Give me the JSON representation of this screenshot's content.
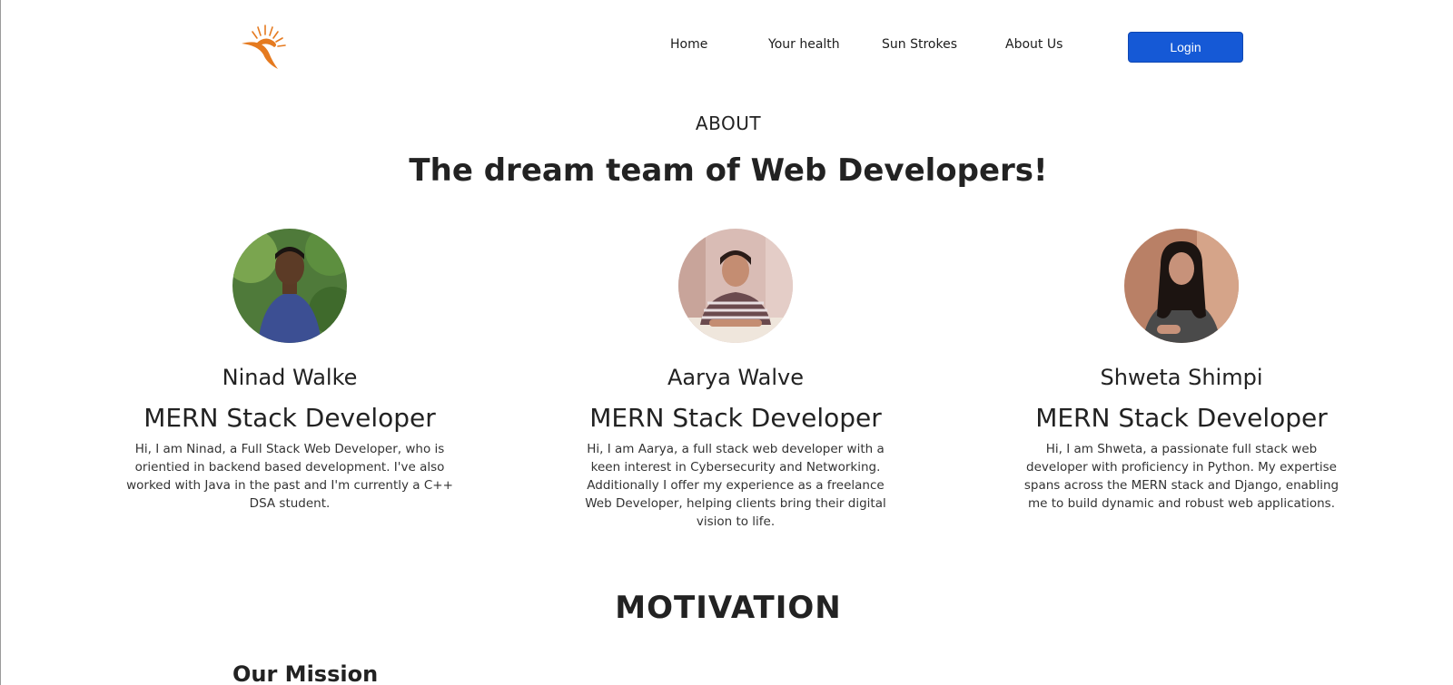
{
  "nav": {
    "items": [
      {
        "label": "Home"
      },
      {
        "label": "Your health"
      },
      {
        "label": "Sun Strokes"
      },
      {
        "label": "About Us"
      }
    ],
    "login_label": "Login"
  },
  "brand": {
    "logo_icon": "sun-logo-icon",
    "accent": "#e57a1f"
  },
  "about": {
    "label": "ABOUT",
    "title": "The dream team of Web Developers!"
  },
  "team": [
    {
      "name": "Ninad Walke",
      "role": "MERN Stack Developer",
      "bio": "Hi, I am Ninad, a Full Stack Web Developer, who is orientied in backend based development. I've also worked with Java in the past and I'm currently a C++ DSA student."
    },
    {
      "name": "Aarya Walve",
      "role": "MERN Stack Developer",
      "bio": "Hi, I am Aarya, a full stack web developer with a keen interest in Cybersecurity and Networking. Additionally I offer my experience as a freelance Web Developer, helping clients bring their digital vision to life."
    },
    {
      "name": "Shweta Shimpi",
      "role": "MERN Stack Developer",
      "bio": "Hi, I am Shweta, a passionate full stack web developer with proficiency in Python. My expertise spans across the MERN stack and Django, enabling me to build dynamic and robust web applications."
    }
  ],
  "motivation": {
    "title": "MOTIVATION",
    "mission_heading": "Our Mission"
  },
  "colors": {
    "primary_button": "#1559d6",
    "text": "#222222"
  }
}
